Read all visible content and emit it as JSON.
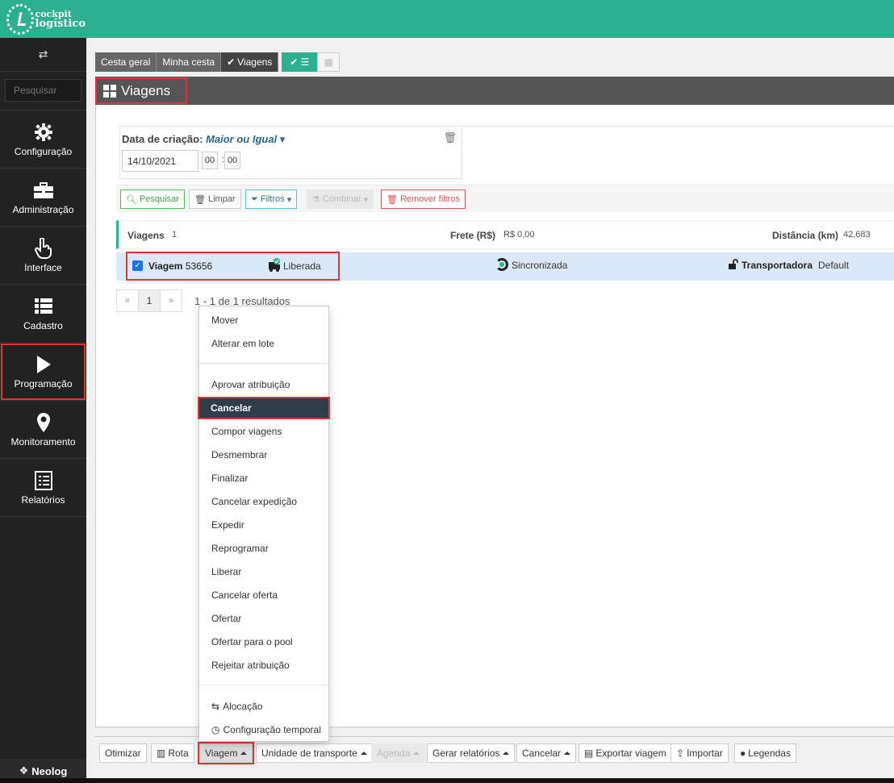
{
  "brand": {
    "logo_line1": "cockpit",
    "logo_line2": "logístico",
    "footer": "Neolog"
  },
  "sidebar": {
    "toggle_icon": "⇄",
    "search_placeholder": "Pesquisar",
    "items": [
      {
        "label": "Configuração",
        "icon": "gear-icon"
      },
      {
        "label": "Administração",
        "icon": "briefcase-icon"
      },
      {
        "label": "Interface",
        "icon": "pointer-hand-icon"
      },
      {
        "label": "Cadastro",
        "icon": "list-icon"
      },
      {
        "label": "Programação",
        "icon": "play-icon",
        "active": true
      },
      {
        "label": "Monitoramento",
        "icon": "map-marker-icon"
      },
      {
        "label": "Relatórios",
        "icon": "report-icon"
      }
    ]
  },
  "viewtabs": {
    "tab1": "Cesta geral",
    "tab2": "Minha cesta",
    "tab3": "Viagens"
  },
  "page": {
    "title": "Viagens"
  },
  "filter": {
    "label": "Data de criação:",
    "operator": "Maior ou Igual",
    "date": "14/10/2021",
    "hour": "00",
    "minute": "00"
  },
  "actions": {
    "search": "Pesquisar",
    "clear": "Limpar",
    "filters": "Filtros",
    "combine": "Combinar",
    "remove_filters": "Remover filtros"
  },
  "summary": {
    "trips_label": "Viagens",
    "trips_value": "1",
    "freight_label": "Frete (R$)",
    "freight_value": "R$ 0,00",
    "distance_label": "Distância (km)",
    "distance_value": "42,683"
  },
  "trip": {
    "label": "Viagem",
    "number": "53656",
    "status": "Liberada",
    "sync": "Sincronizada",
    "carrier_label": "Transportadora",
    "carrier_value": "Default"
  },
  "pager": {
    "prev": "«",
    "page": "1",
    "next": "»",
    "summary": "1 - 1 de 1 resultados"
  },
  "menu": {
    "group1": [
      "Mover",
      "Alterar em lote"
    ],
    "group2": [
      "Aprovar atribuição",
      "Cancelar",
      "Compor viagens",
      "Desmembrar",
      "Finalizar",
      "Cancelar expedição",
      "Expedir",
      "Reprogramar",
      "Liberar",
      "Cancelar oferta",
      "Ofertar",
      "Ofertar para o pool",
      "Rejeitar atribuição"
    ],
    "group3": [
      "Alocação",
      "Configuração temporal"
    ],
    "selected": "Cancelar"
  },
  "bottombar": {
    "optimize": "Otimizar",
    "route": "Rota",
    "trip": "Viagem",
    "transport_unit": "Unidade de transporte",
    "schedule": "Agenda",
    "reports": "Gerar relatórios",
    "cancel": "Cancelar",
    "export": "Exportar viagem",
    "import": "Importar",
    "legends": "Legendas"
  },
  "colors": {
    "accent": "#2cb08f",
    "highlight": "#e53333",
    "selected_row": "#d9e9f9",
    "menu_active": "#2f3d4b"
  }
}
